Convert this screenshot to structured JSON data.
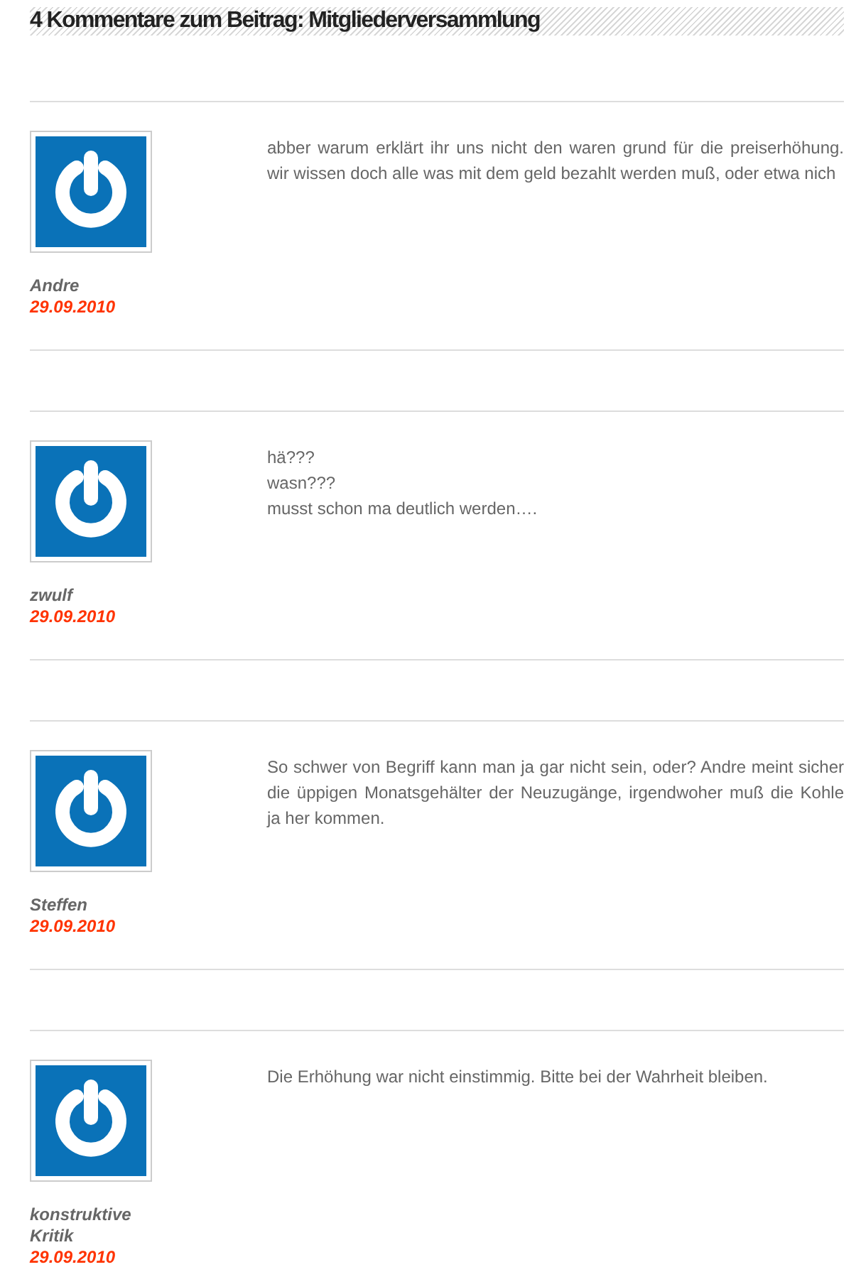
{
  "heading": "4 Kommentare zum Beitrag: Mitgliederversammlung",
  "comments": [
    {
      "author": "Andre",
      "date": "29.09.2010",
      "lines": [
        "abber warum erklärt ihr uns nicht den waren grund für die preiserhöhung. wir wissen doch alle was mit dem geld bezahlt werden muß, oder etwa nich"
      ]
    },
    {
      "author": "zwulf",
      "date": "29.09.2010",
      "lines": [
        "hä???",
        "wasn???",
        "musst schon ma deutlich werden…."
      ]
    },
    {
      "author": "Steffen",
      "date": "29.09.2010",
      "lines": [
        "So schwer von Begriff kann man ja gar nicht sein, oder? Andre meint sicher die üppigen Monatsgehälter der Neuzugänge, irgendwoher muß die Kohle ja her kommen."
      ]
    },
    {
      "author": "konstruktive Kritik",
      "date": "29.09.2010",
      "lines": [
        "Die Erhöhung war nicht einstimmig. Bitte bei der Wahrheit bleiben."
      ]
    }
  ]
}
